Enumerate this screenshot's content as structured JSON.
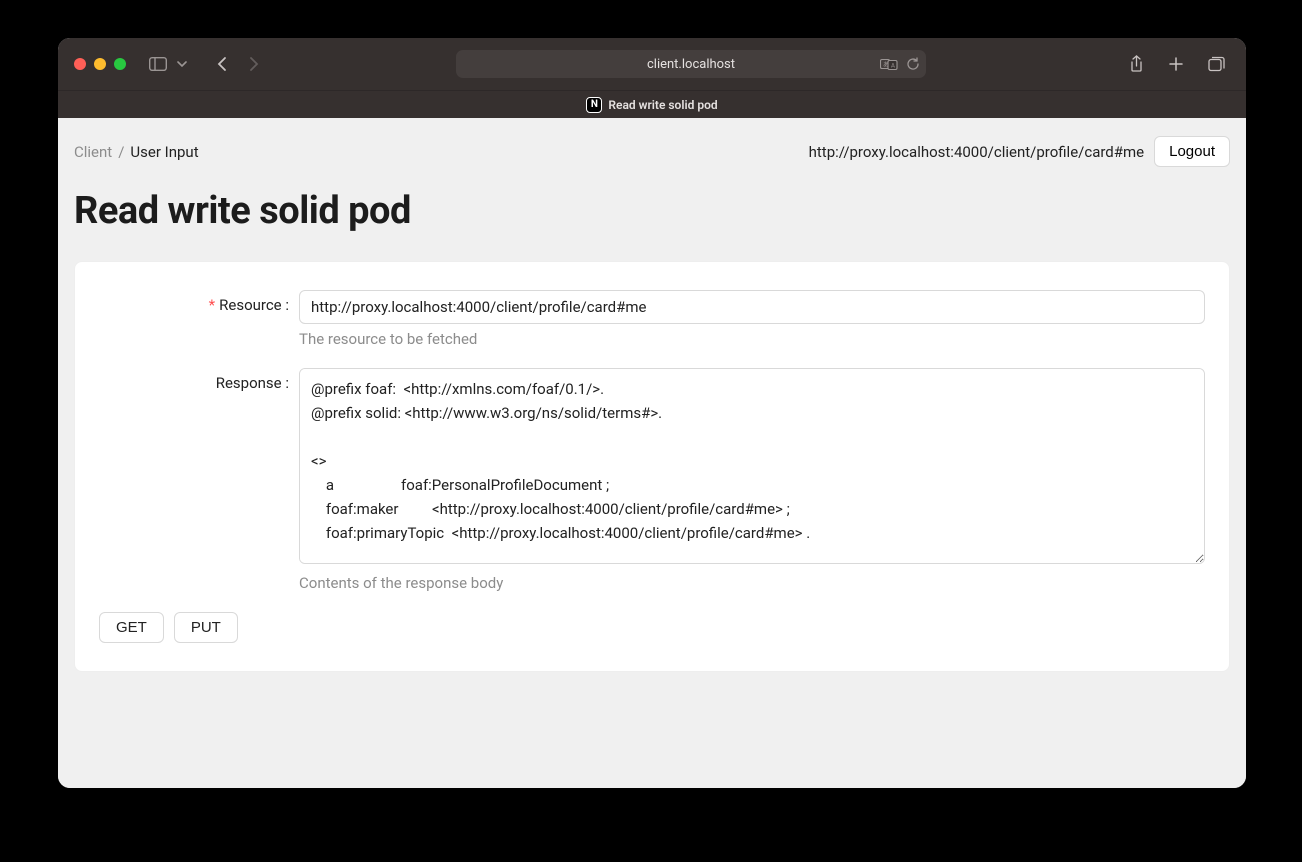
{
  "browser": {
    "address": "client.localhost",
    "tab_title": "Read write solid pod"
  },
  "breadcrumb": {
    "items": [
      "Client",
      "User Input"
    ]
  },
  "user": {
    "webid": "http://proxy.localhost:4000/client/profile/card#me",
    "logout_label": "Logout"
  },
  "page": {
    "title": "Read write solid pod"
  },
  "form": {
    "resource": {
      "label": "Resource",
      "value": "http://proxy.localhost:4000/client/profile/card#me",
      "help": "The resource to be fetched"
    },
    "response": {
      "label": "Response",
      "value": "@prefix foaf:  <http://xmlns.com/foaf/0.1/>.\n@prefix solid: <http://www.w3.org/ns/solid/terms#>.\n\n<>\n    a                  foaf:PersonalProfileDocument ;\n    foaf:maker         <http://proxy.localhost:4000/client/profile/card#me> ;\n    foaf:primaryTopic  <http://proxy.localhost:4000/client/profile/card#me> .\n",
      "help": "Contents of the response body"
    },
    "buttons": {
      "get": "GET",
      "put": "PUT"
    }
  }
}
